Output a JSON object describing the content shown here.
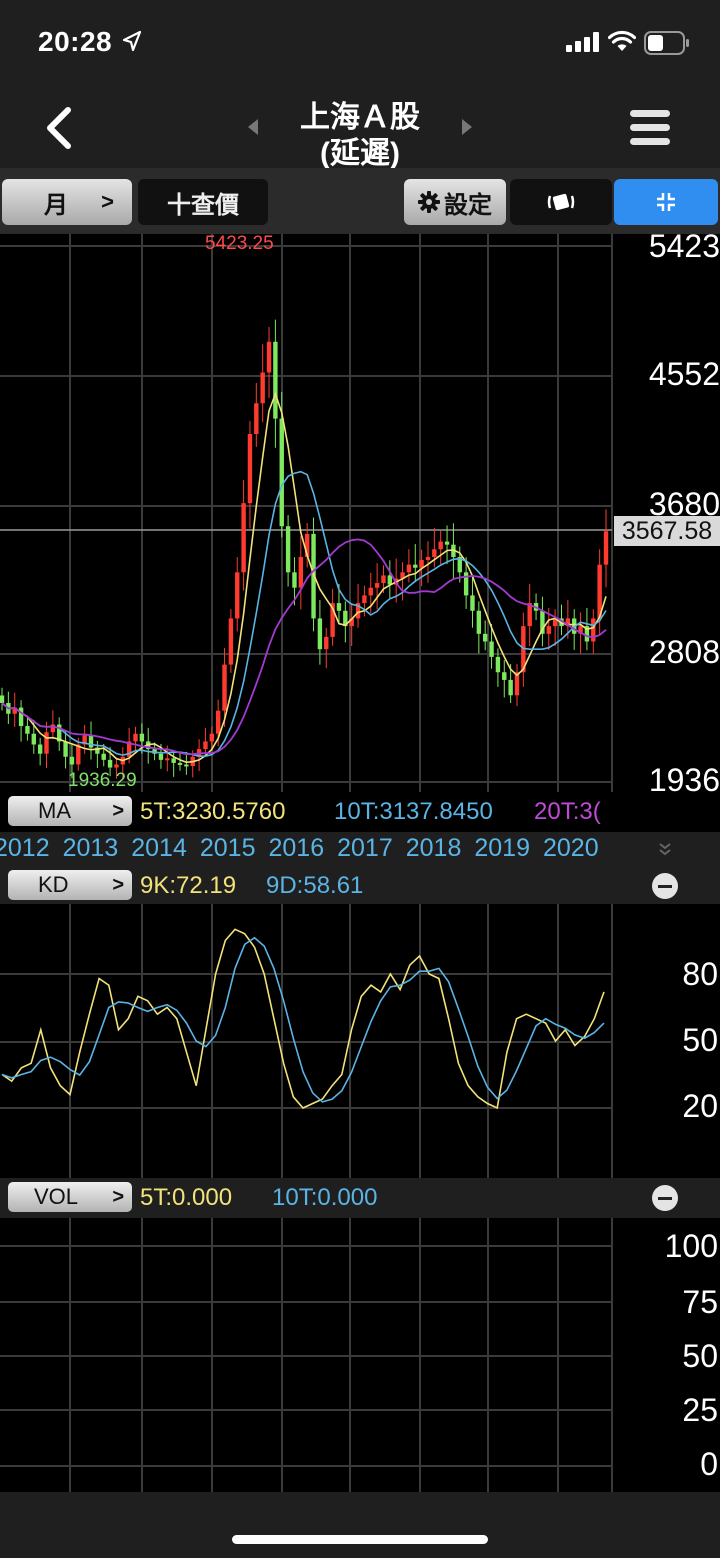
{
  "status": {
    "time": "20:28"
  },
  "nav": {
    "title_line1": "上海Ａ股",
    "title_line2": "(延遲)"
  },
  "toolbar": {
    "period_label": "月",
    "period_chevron": ">",
    "query_label": "十查價",
    "setting_label": "設定"
  },
  "price_chart": {
    "axis_labels": [
      "5423",
      "4552",
      "3680",
      "2808",
      "1936"
    ],
    "current_price": "3567.58",
    "high_label": "5423.25",
    "low_label": "1936.29"
  },
  "ma_legend": {
    "pill_label": "MA",
    "ma5": "5T:3230.5760",
    "ma10": "10T:3137.8450",
    "ma20": "20T:3("
  },
  "years": [
    "2012",
    "2013",
    "2014",
    "2015",
    "2016",
    "2017",
    "2018",
    "2019",
    "2020"
  ],
  "kd_legend": {
    "pill_label": "KD",
    "k": "9K:72.19",
    "d": "9D:58.61",
    "axis_labels": [
      "80",
      "50",
      "20"
    ]
  },
  "vol_legend": {
    "pill_label": "VOL",
    "v5": "5T:0.000",
    "v10": "10T:0.000",
    "axis_labels": [
      "100",
      "75",
      "50",
      "25",
      "0"
    ]
  },
  "colors": {
    "up": "#ff3b30",
    "down": "#7ee85e",
    "ma5": "#f2e27a",
    "ma10": "#5ab4e6",
    "ma20": "#a23ad0",
    "accent": "#2f8ef0"
  },
  "chart_data": {
    "type": "candlestick",
    "title": "上海A股 (月)",
    "x": [
      "2012",
      "2013",
      "2014",
      "2015",
      "2016",
      "2017",
      "2018",
      "2019",
      "2020"
    ],
    "ylim": [
      1936,
      5423
    ],
    "high": 5423.25,
    "low": 1936.29,
    "last": 3567.58,
    "series": [
      {
        "name": "5T",
        "value": 3230.576
      },
      {
        "name": "10T",
        "value": 3137.845
      },
      {
        "name": "9K",
        "value": 72.19
      },
      {
        "name": "9D",
        "value": 58.61
      }
    ]
  }
}
